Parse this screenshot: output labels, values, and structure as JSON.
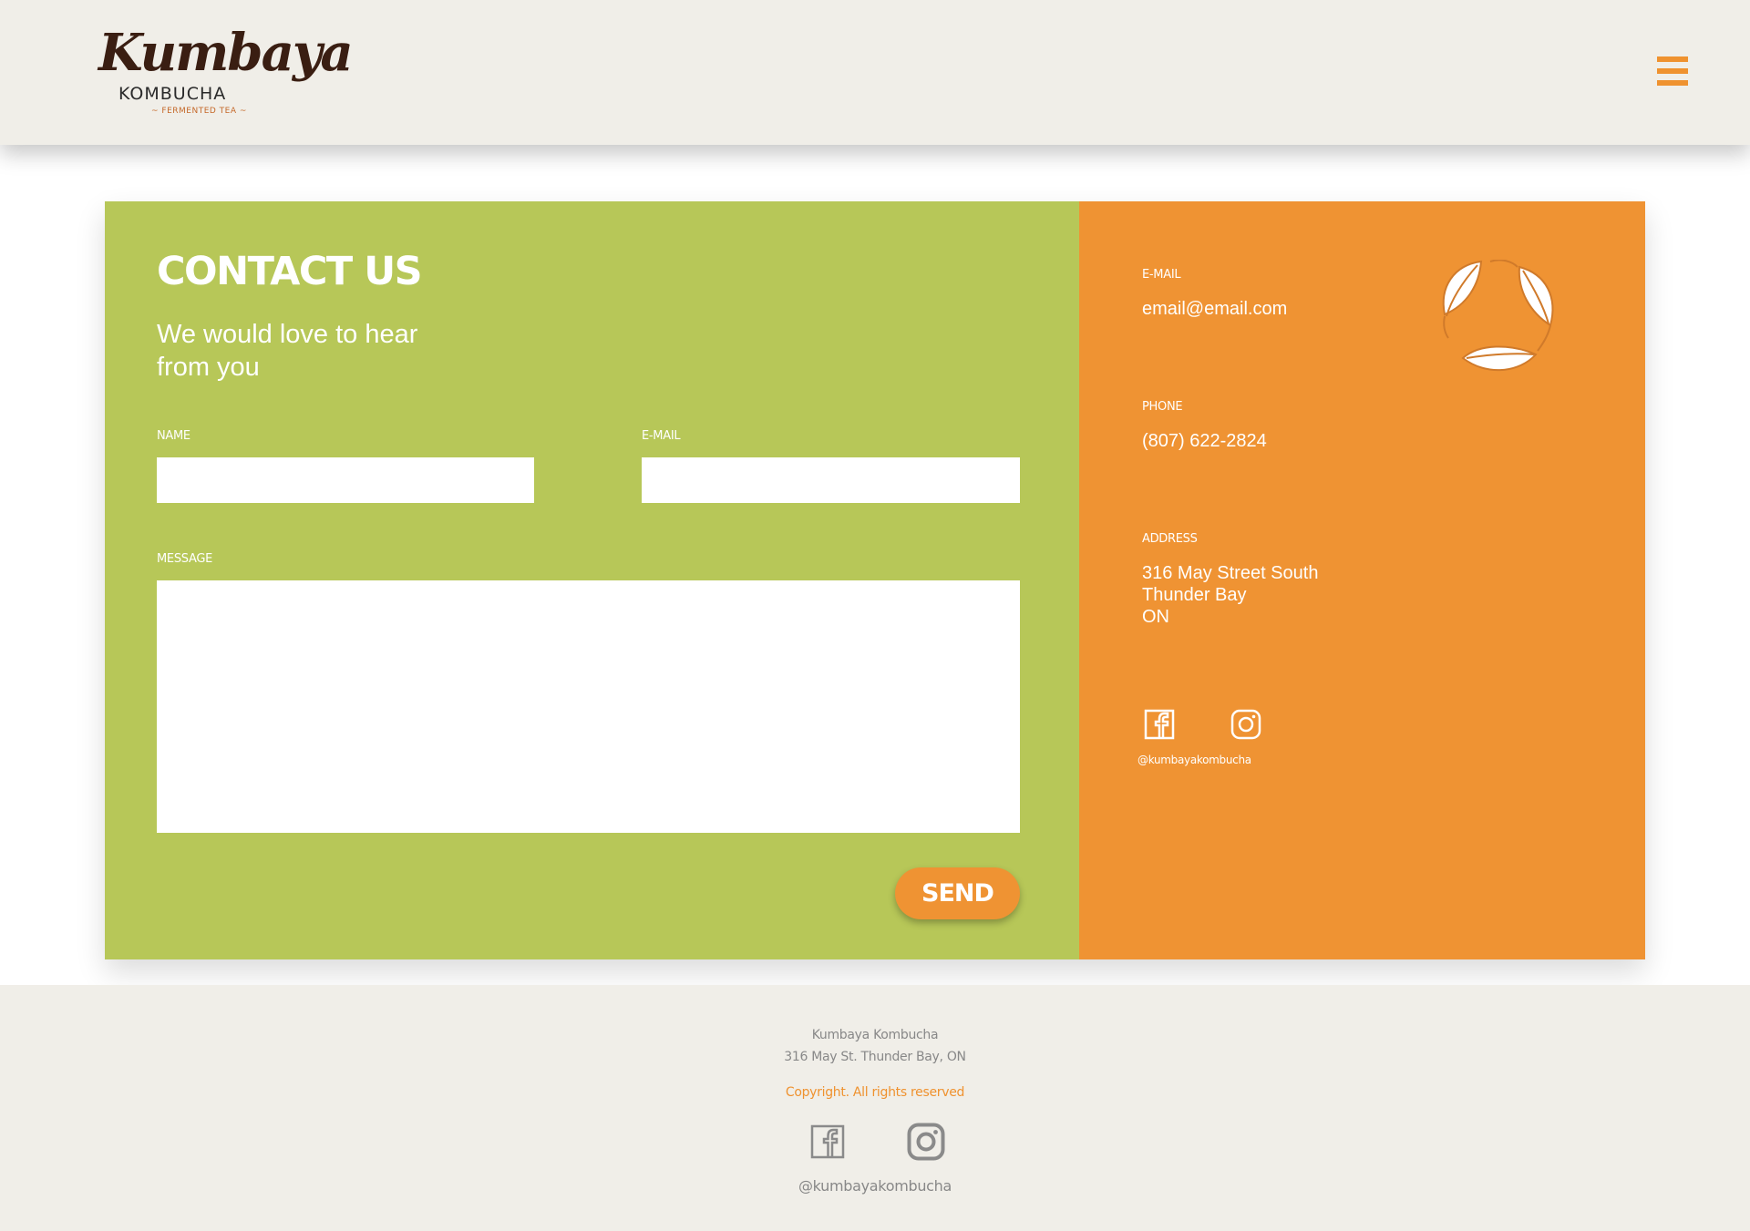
{
  "header": {
    "logo": {
      "script": "Kumbaya",
      "sub": "KOMBUCHA",
      "tagline": "~ FERMENTED TEA ~"
    },
    "menu_icon": "hamburger-menu-icon"
  },
  "contact": {
    "title": "CONTACT US",
    "subtitle": "We would love to hear from you",
    "name_label": "NAME",
    "email_label": "E-MAIL",
    "message_label": "MESSAGE",
    "name_value": "",
    "email_value": "",
    "message_value": "",
    "send_label": "SEND"
  },
  "info": {
    "email_label": "E-MAIL",
    "email": "email@email.com",
    "phone_label": "PHONE",
    "phone": "(807) 622-2824",
    "address_label": "ADDRESS",
    "address_line1": "316 May Street South",
    "address_line2": "Thunder Bay",
    "address_line3": "ON",
    "social_handle": "@kumbayakombucha",
    "icons": [
      "leaves-icon",
      "facebook-icon",
      "instagram-icon"
    ]
  },
  "footer": {
    "company": "Kumbaya Kombucha",
    "address": "316 May St. Thunder Bay, ON",
    "copyright": "Copyright. All rights reserved",
    "social_handle": "@kumbayakombucha"
  },
  "colors": {
    "green": "#b7c758",
    "orange": "#ef9333",
    "background_beige": "#f0eee8",
    "footer_text": "#888888"
  }
}
